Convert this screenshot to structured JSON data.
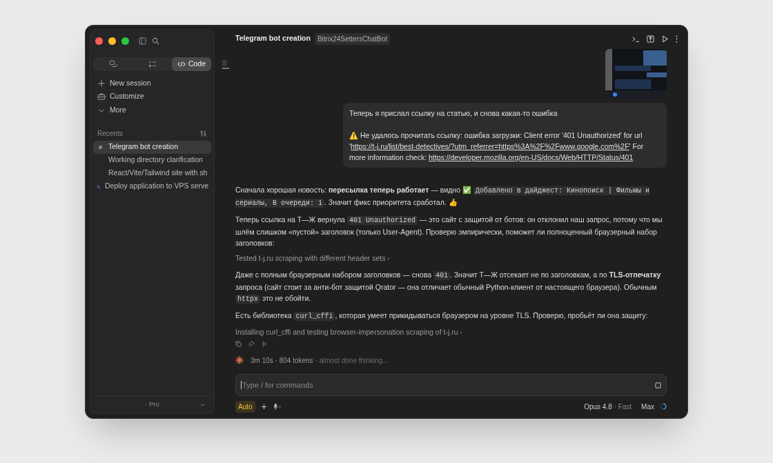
{
  "sidebar": {
    "mode_tabs": [
      {
        "kind": "chat",
        "selected": false
      },
      {
        "kind": "tasks",
        "selected": false
      },
      {
        "kind": "code",
        "label": "Code",
        "selected": true
      }
    ],
    "actions": [
      {
        "kind": "new",
        "label": "New session"
      },
      {
        "kind": "customize",
        "label": "Customize"
      },
      {
        "kind": "more",
        "label": "More"
      }
    ],
    "recents_title": "Recents",
    "recents": [
      {
        "kind": "session",
        "label": "Telegram bot creation",
        "selected": true
      },
      {
        "kind": "session",
        "label": "Working directory clarification",
        "selected": false
      },
      {
        "kind": "session",
        "label": "React/Vite/Tailwind site with sh",
        "selected": false
      },
      {
        "kind": "worktree",
        "label": "Deploy application to VPS serve",
        "selected": false
      }
    ],
    "plan": "· Pro"
  },
  "header": {
    "title": "Telegram bot creation",
    "repo": "Bitrix24SettersChatBot"
  },
  "user_message": {
    "text": "Теперь я прислал ссылку на статью, и снова какая-то ошибка",
    "warning_icon": "⚠️",
    "warning_text": "Не удалось прочитать ссылку: ошибка загрузки: Client error '401 Unauthorized' for url",
    "url_prefix": "'",
    "url": "https://t-j.ru/list/best-detectives/?utm_referrer=https%3A%2F%2Fwww.google.com%2F",
    "url_suffix": "'",
    "info_label": "For more information check:",
    "info_url": "https://developer.mozilla.org/en-US/docs/Web/HTTP/Status/401"
  },
  "assistant": [
    {
      "kind": "paragraph",
      "segments": [
        {
          "kind": "text",
          "text": "Сначала хорошая новость: **пересылка теперь работает** — видно ✅ "
        },
        {
          "kind": "code",
          "text": "Добавлено в дайджест: Кинопоиск | Фильмы и сериалы, В очереди: 1"
        },
        {
          "kind": "text",
          "text": ". Значит фикс приоритета сработал. 👍"
        }
      ]
    },
    {
      "kind": "paragraph",
      "segments": [
        {
          "kind": "text",
          "text": "Теперь ссылка на Т—Ж вернула "
        },
        {
          "kind": "code",
          "text": "401 Unauthorized"
        },
        {
          "kind": "text",
          "text": " — это сайт с защитой от ботов: он отклонил наш запрос, потому что мы шлём слишком «пустой» заголовок (только User-Agent). Проверю эмпирически, поможет ли полноценный браузерный набор заголовков:"
        }
      ]
    },
    {
      "kind": "tool",
      "label": "Tested t-j.ru scraping with different header sets",
      "chevron": "›"
    },
    {
      "kind": "paragraph",
      "segments": [
        {
          "kind": "text",
          "text": "Даже с полным браузерным набором заголовков — снова "
        },
        {
          "kind": "code",
          "text": "401"
        },
        {
          "kind": "text",
          "text": ". Значит Т—Ж отсекает не по заголовкам, а по **TLS-отпечатку** запроса (сайт стоит за анти-бот защитой Qrator — она отличает обычный Python-клиент от настоящего браузера). Обычным "
        },
        {
          "kind": "code",
          "text": "httpx"
        },
        {
          "kind": "text",
          "text": " это не обойти."
        }
      ]
    },
    {
      "kind": "paragraph",
      "segments": [
        {
          "kind": "text",
          "text": "Есть библиотека "
        },
        {
          "kind": "code",
          "text": "curl_cffi"
        },
        {
          "kind": "text",
          "text": ", которая умеет прикидываться браузером на уровне TLS. Проверю, пробьёт ли она защиту:"
        }
      ]
    },
    {
      "kind": "tool",
      "label": "Installing curl_cffi and testing browser-impersonation scraping of t-j.ru",
      "chevron": "›"
    }
  ],
  "status": {
    "stats": "3m 10s · 804 tokens",
    "note": "· almost done thinking..."
  },
  "composer": {
    "placeholder": "Type / for commands",
    "mode": "Auto",
    "model": "Opus 4.8",
    "speed": "· Fast",
    "effort": "Max"
  }
}
